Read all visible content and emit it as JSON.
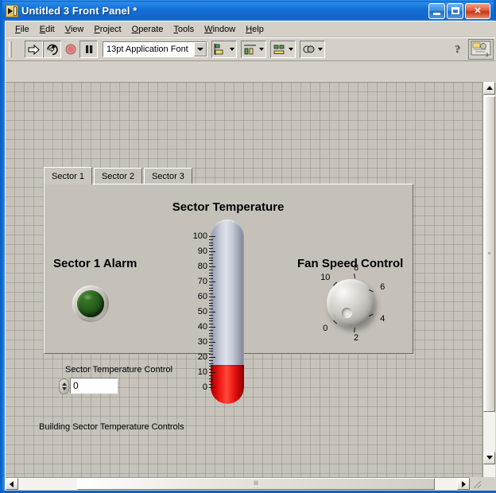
{
  "window": {
    "title": "Untitled 3 Front Panel *",
    "icon": "labview-vi-icon",
    "minimize_label": "",
    "maximize_label": "",
    "close_label": "✕"
  },
  "menubar": {
    "items": [
      {
        "label": "File",
        "mnemonic": "F"
      },
      {
        "label": "Edit",
        "mnemonic": "E"
      },
      {
        "label": "View",
        "mnemonic": "V"
      },
      {
        "label": "Project",
        "mnemonic": "P"
      },
      {
        "label": "Operate",
        "mnemonic": "O"
      },
      {
        "label": "Tools",
        "mnemonic": "T"
      },
      {
        "label": "Window",
        "mnemonic": "W"
      },
      {
        "label": "Help",
        "mnemonic": "H"
      }
    ]
  },
  "toolbar": {
    "run_button": "run-arrow-icon",
    "run_continuously_button": "run-continuously-icon",
    "abort_button": "abort-execution-icon",
    "pause_button": "pause-icon",
    "font_selector": {
      "value": "13pt Application Font",
      "placeholder": "13pt Application Font"
    },
    "align_objects": "align-objects-icon",
    "distribute_objects": "distribute-objects-icon",
    "resize_objects": "resize-objects-icon",
    "reorder_objects": "reorder-objects-icon",
    "context_help": "context-help-icon",
    "vi_icon": "vi-connector-icon"
  },
  "tab_control": {
    "tabs": [
      {
        "label": "Sector 1",
        "active": true
      },
      {
        "label": "Sector 2",
        "active": false
      },
      {
        "label": "Sector 3",
        "active": false
      }
    ]
  },
  "panel": {
    "alarm": {
      "label": "Sector 1 Alarm",
      "state": "off",
      "color_off": "#23531a",
      "color_on": "#2fff2f"
    },
    "thermometer": {
      "title": "Sector Temperature",
      "value": 15,
      "min": 0,
      "max": 100,
      "major_step": 10,
      "minor_step": 2,
      "tick_labels": [
        100,
        90,
        80,
        70,
        60,
        50,
        40,
        30,
        20,
        10,
        0
      ],
      "fill_color": "#ff2a20",
      "tube_color": "#ccd1dd",
      "units": ""
    },
    "knob": {
      "title": "Fan Speed Control",
      "value": 1,
      "min": 0,
      "max": 10,
      "tick_labels": [
        "0",
        "2",
        "4",
        "6",
        "8",
        "10"
      ],
      "tick_values": [
        0,
        2,
        4,
        6,
        8,
        10
      ]
    },
    "numeric_control": {
      "label": "Sector Temperature Control",
      "value": "0",
      "increment_label": "increment",
      "decrement_label": "decrement"
    },
    "free_label": "Building Sector Temperature Controls"
  },
  "scrollbars": {
    "vertical": {
      "up_arrow": "▲",
      "down_arrow": "▼",
      "grip": "≡"
    },
    "horizontal": {
      "left_arrow": "◀",
      "right_arrow": "▶",
      "grip": "‖‖"
    }
  }
}
